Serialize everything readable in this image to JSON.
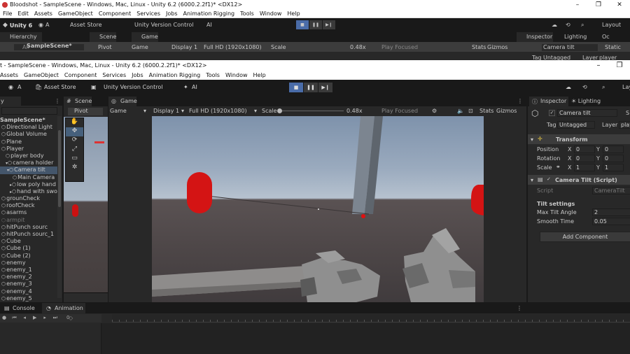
{
  "back_window": {
    "title": "Bloodshot - SampleScene - Windows, Mac, Linux - Unity 6.2 (6000.2.2f1)* <DX12>",
    "menu": [
      "File",
      "Edit",
      "Assets",
      "GameObject",
      "Component",
      "Services",
      "Jobs",
      "Animation Rigging",
      "Tools",
      "Window",
      "Help"
    ],
    "toolbar": {
      "unity": "Unity 6",
      "account": "A",
      "asset_store": "Asset Store",
      "vcs": "Unity Version Control",
      "ai": "AI",
      "layout": "Layout"
    },
    "tabs": {
      "hierarchy": "Hierarchy",
      "scene": "Scene",
      "game": "Game",
      "inspector": "Inspector",
      "lighting": "Lighting",
      "occlusion": "Oc"
    },
    "search_placeholder": "All",
    "scene_item": "SampleScene*",
    "game_ctrl": {
      "display": "Game",
      "display_n": "Display 1",
      "res": "Full HD (1920x1080)",
      "scale_label": "Scale",
      "scale_val": "0.48x",
      "play_focused": "Play Focused",
      "stats": "Stats",
      "gizmos": "Gizmos"
    },
    "pivot": "Pivot",
    "insp_name": "Camera tilt",
    "insp_static": "Static",
    "tag_label": "Tag",
    "tag_val": "Untagged",
    "layer_label": "Layer",
    "layer_val": "player"
  },
  "front_window": {
    "title": "t - SampleScene - Windows, Mac, Linux - Unity 6.2 (6000.2.2f1)* <DX12>",
    "menu": [
      "Assets",
      "GameObject",
      "Component",
      "Services",
      "Jobs",
      "Animation Rigging",
      "Tools",
      "Window",
      "Help"
    ],
    "toolbar": {
      "account": "A",
      "asset_store": "Asset Store",
      "vcs": "Unity Version Control",
      "ai": "AI",
      "layout": "Lay"
    },
    "hierarchy": {
      "tab": "y",
      "items": [
        {
          "label": "SampleScene*",
          "bold": true
        },
        {
          "label": "Directional Light"
        },
        {
          "label": "Global Volume"
        },
        {
          "label": "Plane"
        },
        {
          "label": "Player"
        },
        {
          "label": "player body"
        },
        {
          "label": "camera holder"
        },
        {
          "label": "Camera tilt",
          "selected": true
        },
        {
          "label": "Main Camera"
        },
        {
          "label": "low poly hand"
        },
        {
          "label": "hand with swo"
        },
        {
          "label": "grounCheck"
        },
        {
          "label": "roofCheck"
        },
        {
          "label": "asarms"
        },
        {
          "label": "armpit",
          "dim": true
        },
        {
          "label": "hitPunch sourc"
        },
        {
          "label": "hitPunch sourc_1"
        },
        {
          "label": "Cube"
        },
        {
          "label": "Cube (1)"
        },
        {
          "label": "Cube (2)"
        },
        {
          "label": "enemy"
        },
        {
          "label": "enemy_1"
        },
        {
          "label": "enemy_2"
        },
        {
          "label": "enemy_3"
        },
        {
          "label": "enemy_4"
        },
        {
          "label": "enemy_5"
        }
      ]
    },
    "scene": {
      "tab": "Scene",
      "pivot": "Pivot",
      "tools": [
        "✋",
        "✥",
        "⟳",
        "⤢",
        "▭",
        "✲"
      ]
    },
    "game": {
      "tab": "Game",
      "mode": "Game",
      "display": "Display 1",
      "resolution": "Full HD (1920x1080)",
      "scale_label": "Scale",
      "scale_value": "0.48x",
      "play_focused": "Play Focused",
      "stats": "Stats",
      "gizmos": "Gizmos"
    },
    "inspector": {
      "tab": "Inspector",
      "tab2": "Lighting",
      "object_name": "Camera tilt",
      "static_abbr": "S",
      "tag_label": "Tag",
      "tag_value": "Untagged",
      "layer_label": "Layer",
      "layer_value": "playe",
      "transform": {
        "title": "Transform",
        "position_label": "Position",
        "rotation_label": "Rotation",
        "scale_label": "Scale",
        "x": "X",
        "y": "Y",
        "pos_x": "0",
        "pos_y": "0",
        "rot_x": "0",
        "rot_y": "0",
        "scale_x": "1",
        "scale_y": "1"
      },
      "script_component": {
        "title": "Camera Tilt (Script)",
        "script_label": "Script",
        "script_value": "CameraTilt",
        "section": "Tilt settings",
        "max_tilt_label": "Max Tilt Angle",
        "max_tilt_value": "2",
        "smooth_label": "Smooth Time",
        "smooth_value": "0.05"
      },
      "add_component": "Add Component"
    },
    "bottom": {
      "console": "Console",
      "animation": "Animation",
      "frame": "0"
    }
  },
  "colors": {
    "panel": "#282828",
    "dark": "#191919",
    "selected": "#44566b",
    "play_active": "#4a6ca8",
    "capsule_red": "#d41414"
  }
}
